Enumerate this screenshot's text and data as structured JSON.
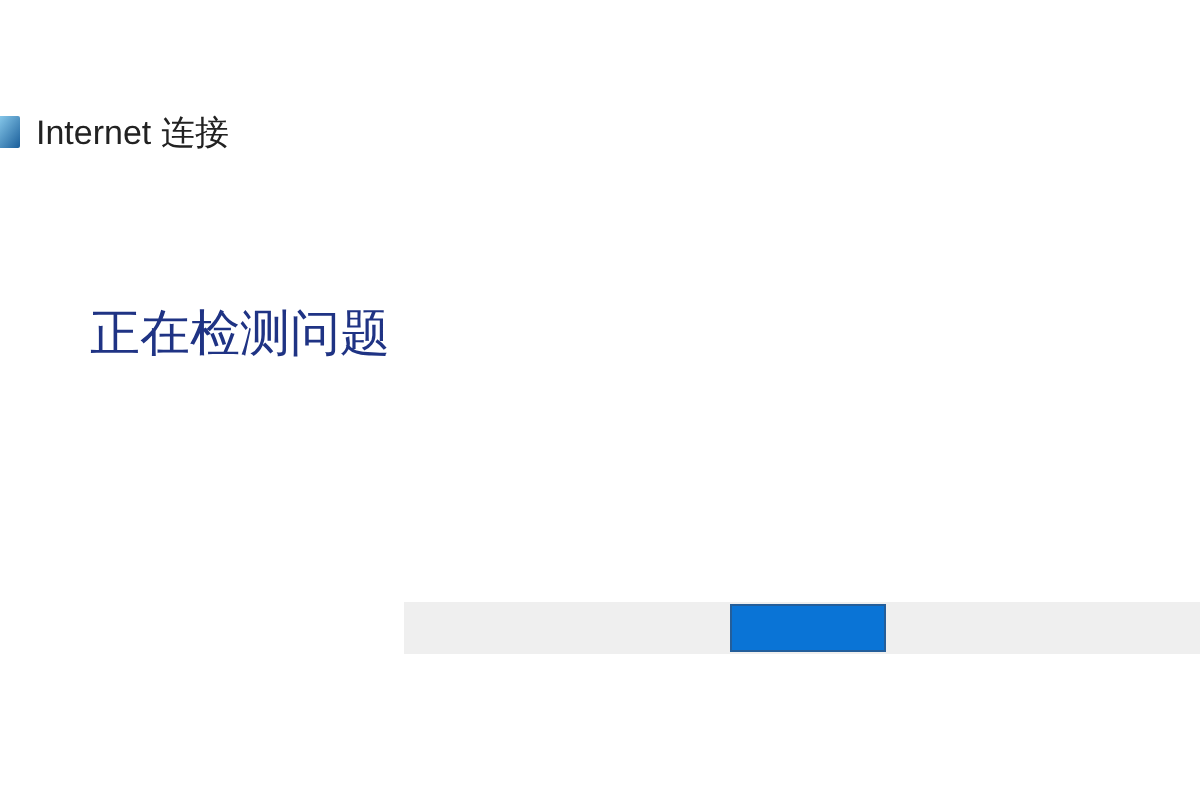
{
  "window": {
    "title": "Internet 连接"
  },
  "heading": "正在检测问题",
  "progress": {
    "indeterminate": true
  }
}
